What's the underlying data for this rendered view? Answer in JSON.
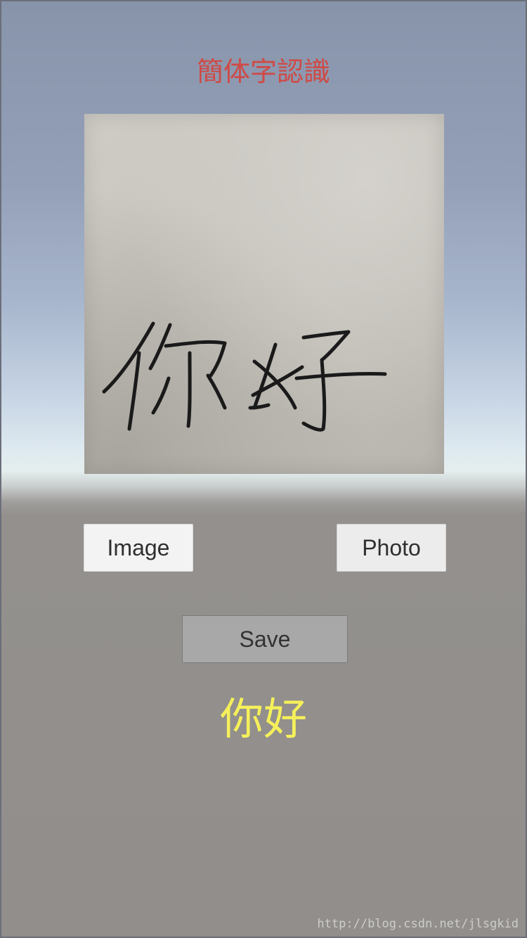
{
  "title": "簡体字認識",
  "buttons": {
    "image_label": "Image",
    "photo_label": "Photo",
    "save_label": "Save"
  },
  "result_text": "你好",
  "watermark": "http://blog.csdn.net/jlsgkid",
  "colors": {
    "title": "#cf4a46",
    "result": "#f5f05a",
    "background_lower": "#918e8b",
    "background_upper": "#8894aa"
  }
}
